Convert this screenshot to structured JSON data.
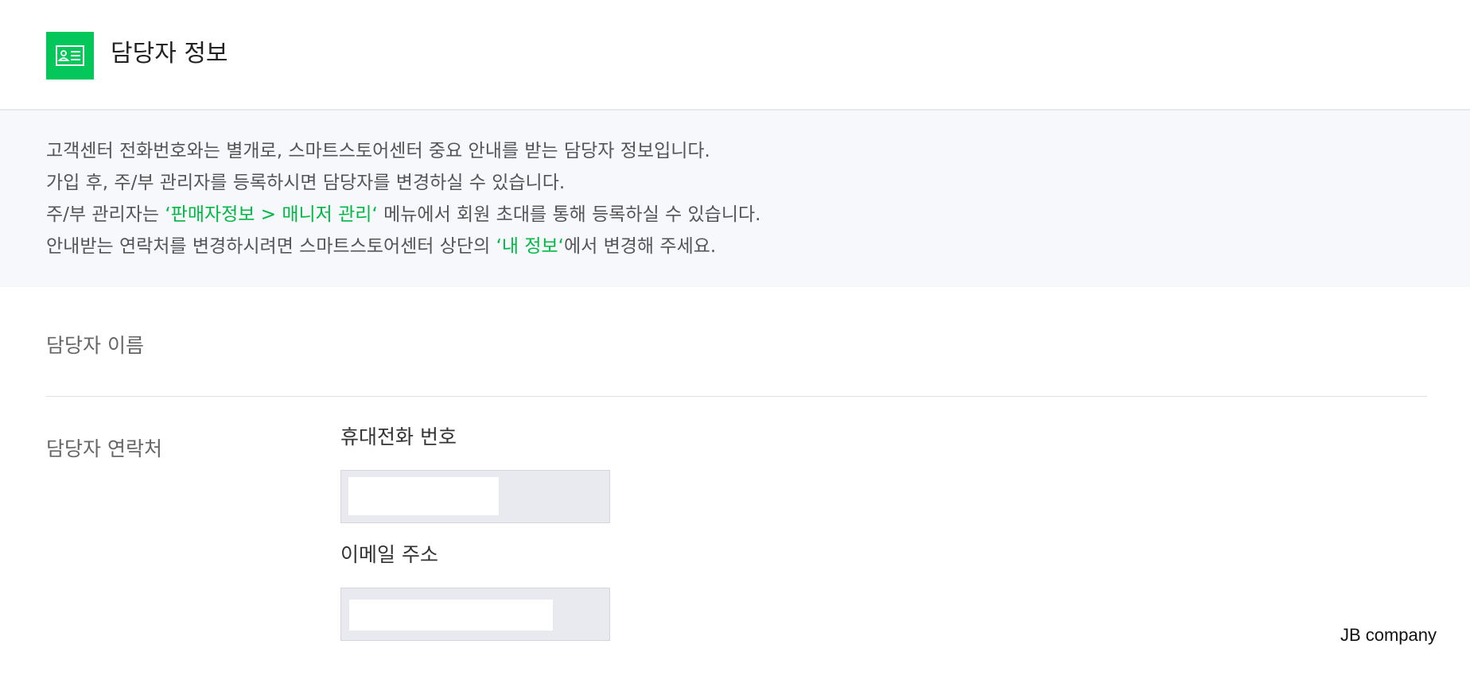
{
  "header": {
    "title": "담당자 정보",
    "icon": "contact-card-icon",
    "icon_bg": "#03c75a"
  },
  "notice": {
    "line1": "고객센터 전화번호와는 별개로, 스마트스토어센터 중요 안내를 받는 담당자 정보입니다.",
    "line2": "가입 후, 주/부 관리자를 등록하시면 담당자를 변경하실 수 있습니다.",
    "line3_pre": "주/부 관리자는 ",
    "line3_link": "‘판매자정보 > 매니저 관리‘",
    "line3_post": " 메뉴에서 회원 초대를 통해 등록하실 수 있습니다.",
    "line4_pre": "안내받는 연락처를 변경하시려면 스마트스토어센터 상단의 ",
    "line4_link": "‘내 정보‘",
    "line4_post": "에서 변경해 주세요.",
    "highlight_color": "#00b843"
  },
  "form": {
    "name_label": "담당자 이름",
    "contact_label": "담당자 연락처",
    "phone_label": "휴대전화 번호",
    "phone_value": "",
    "email_label": "이메일 주소",
    "email_value": ""
  },
  "footer": {
    "brand": "JB company"
  }
}
